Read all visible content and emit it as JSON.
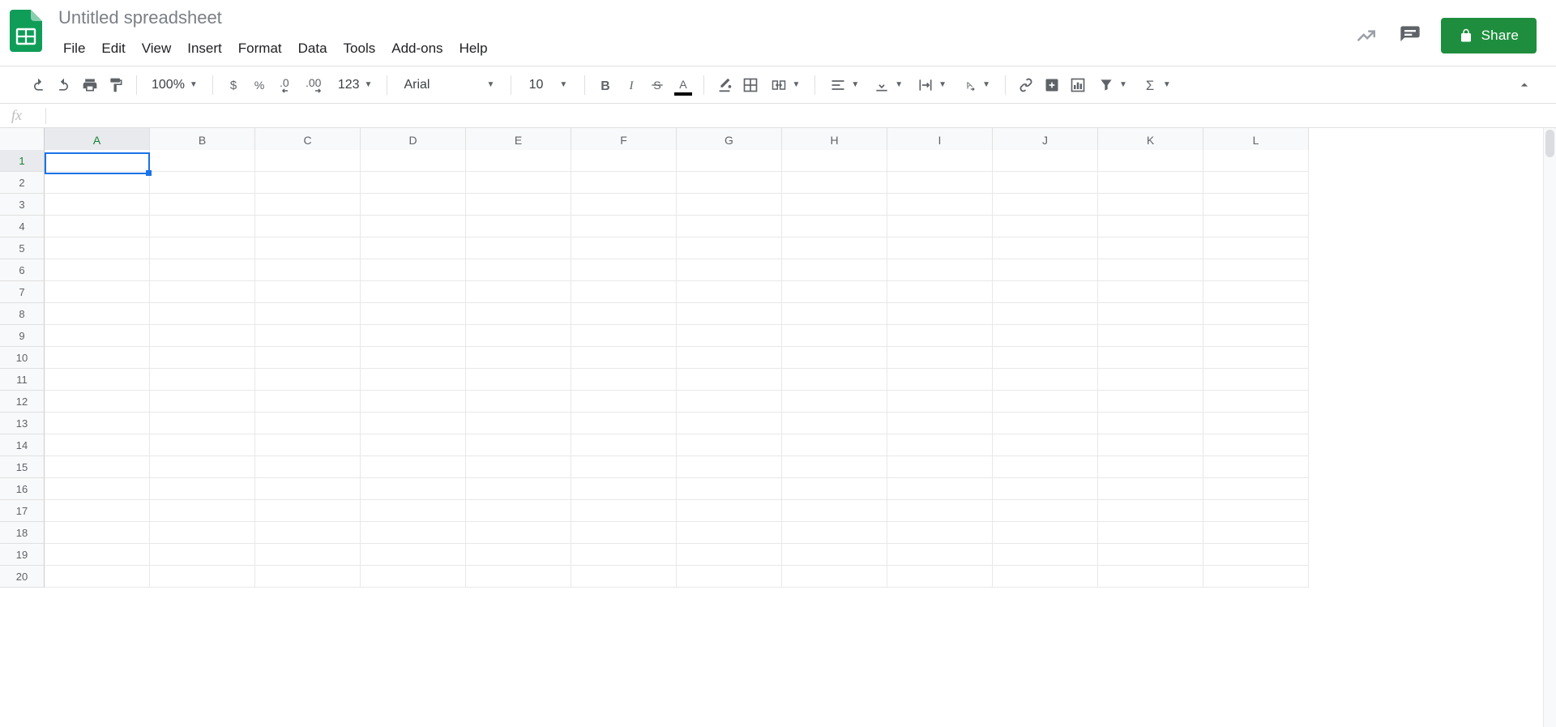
{
  "doc": {
    "title": "Untitled spreadsheet"
  },
  "menu": {
    "items": [
      "File",
      "Edit",
      "View",
      "Insert",
      "Format",
      "Data",
      "Tools",
      "Add-ons",
      "Help"
    ]
  },
  "share": {
    "label": "Share"
  },
  "toolbar": {
    "zoom": "100%",
    "number_format": "123",
    "font": "Arial",
    "font_size": "10",
    "decrease_decimal": ".0",
    "increase_decimal": ".00"
  },
  "formula": {
    "fx": "fx",
    "value": ""
  },
  "grid": {
    "columns": [
      "A",
      "B",
      "C",
      "D",
      "E",
      "F",
      "G",
      "H",
      "I",
      "J",
      "K",
      "L"
    ],
    "rows": [
      "1",
      "2",
      "3",
      "4",
      "5",
      "6",
      "7",
      "8",
      "9",
      "10",
      "11",
      "12",
      "13",
      "14",
      "15",
      "16",
      "17",
      "18",
      "19",
      "20"
    ],
    "active_cell": "A1"
  }
}
